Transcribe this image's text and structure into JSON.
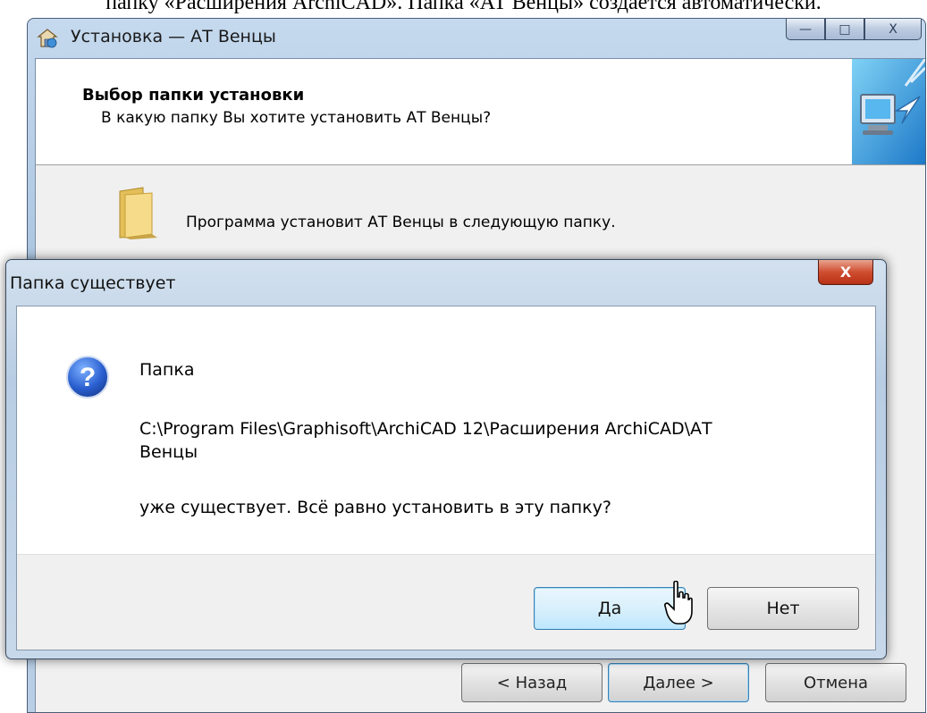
{
  "document": {
    "text": "папку «Расширения ArchiCAD». Папка «АТ Венцы» создается автоматически."
  },
  "installer": {
    "title": "Установка — АТ Венцы",
    "header_title": "Выбор папки установки",
    "header_subtitle": "В какую папку Вы хотите установить АТ Венцы?",
    "body_text": "Программа установит АТ Венцы в следующую папку.",
    "caption_buttons": {
      "minimize": "—",
      "maximize": "□",
      "close": "X"
    },
    "buttons": {
      "back": "< Назад",
      "next": "Далее >",
      "cancel": "Отмена"
    }
  },
  "dialog": {
    "title": "Папка существует",
    "close_label": "X",
    "message_line1": "Папка",
    "message_path_line1": "C:\\Program Files\\Graphisoft\\ArchiCAD 12\\Расширения ArchiCAD\\АТ",
    "message_path_line2": "Венцы",
    "message_line3": "уже существует. Всё равно установить в эту папку?",
    "buttons": {
      "yes": "Да",
      "no": "Нет"
    },
    "icon": "question-icon"
  },
  "colors": {
    "window_frame": "#b9cfe6",
    "default_button_border": "#3c7fb1",
    "close_button": "#cf4d30"
  }
}
